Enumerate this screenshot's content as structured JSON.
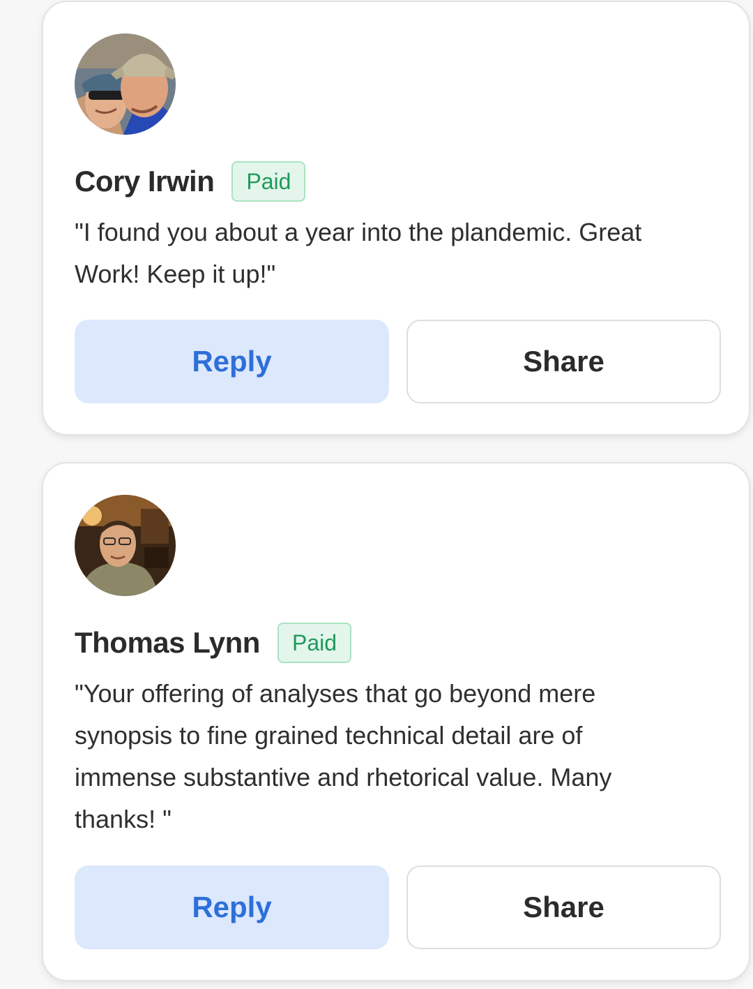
{
  "comments": [
    {
      "author": "Cory Irwin",
      "badge": "Paid",
      "text": "\"I found you about a year into the plandemic. Great Work! Keep it up!\"",
      "reply_label": "Reply",
      "share_label": "Share"
    },
    {
      "author": "Thomas Lynn",
      "badge": "Paid",
      "text": "\"Your offering of analyses that go beyond mere synopsis to fine grained technical detail are of immense substantive and rhetorical value. Many thanks! \"",
      "reply_label": "Reply",
      "share_label": "Share"
    }
  ],
  "colors": {
    "badge_text": "#1f9a5b",
    "badge_bg": "#e4f6ec",
    "reply_text": "#2e6fd9",
    "reply_bg": "#dce8fc"
  }
}
